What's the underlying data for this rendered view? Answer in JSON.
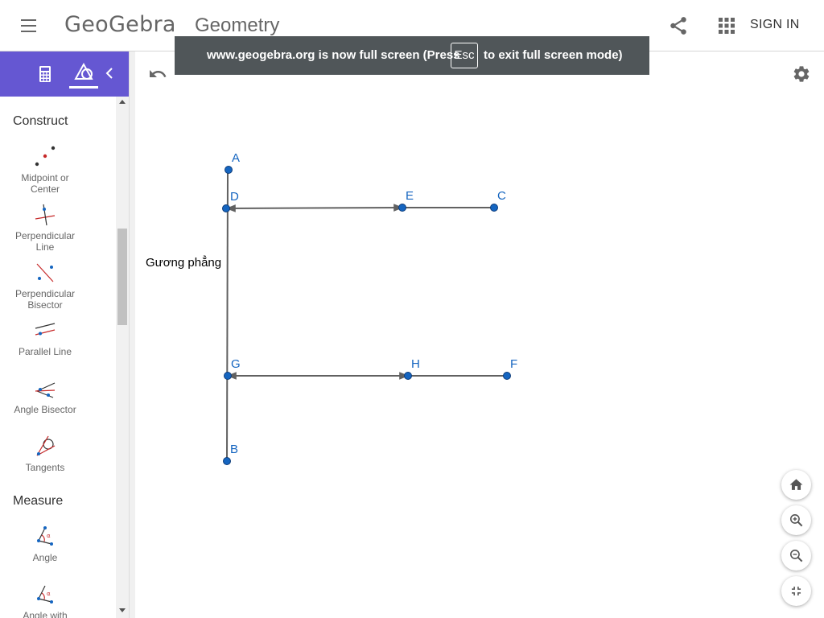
{
  "header": {
    "logo": "GeoGebra",
    "app_title": "Geometry",
    "sign_in": "SIGN IN"
  },
  "sidebar": {
    "sections": [
      {
        "title": "Construct"
      },
      {
        "title": "Measure"
      }
    ],
    "tools": [
      {
        "label_line1": "Midpoint or",
        "label_line2": "Center",
        "icon": "midpoint-icon"
      },
      {
        "label_line1": "Perpendicular",
        "label_line2": "Line",
        "icon": "perpendicular-line-icon"
      },
      {
        "label_line1": "Perpendicular",
        "label_line2": "Bisector",
        "icon": "perpendicular-bisector-icon"
      },
      {
        "label_line1": "Parallel Line",
        "label_line2": "",
        "icon": "parallel-line-icon"
      },
      {
        "label_line1": "Angle Bisector",
        "label_line2": "",
        "icon": "angle-bisector-icon"
      },
      {
        "label_line1": "Tangents",
        "label_line2": "",
        "icon": "tangents-icon"
      },
      {
        "label_line1": "Angle",
        "label_line2": "",
        "icon": "angle-icon"
      },
      {
        "label_line1": "Angle with",
        "label_line2": "",
        "icon": "angle-fixed-size-icon"
      }
    ]
  },
  "banner": {
    "text_before": "www.geogebra.org is now full screen (Press",
    "key": "Esc",
    "text_after": "to exit full screen mode)"
  },
  "canvas": {
    "mirror_label": "Gương phẳng",
    "points": {
      "A": "A",
      "B": "B",
      "C": "C",
      "D": "D",
      "E": "E",
      "F": "F",
      "G": "G",
      "H": "H"
    }
  },
  "colors": {
    "accent": "#6557d2",
    "point_fill": "#1565c0",
    "point_label": "#1565c0",
    "line": "#616161"
  }
}
